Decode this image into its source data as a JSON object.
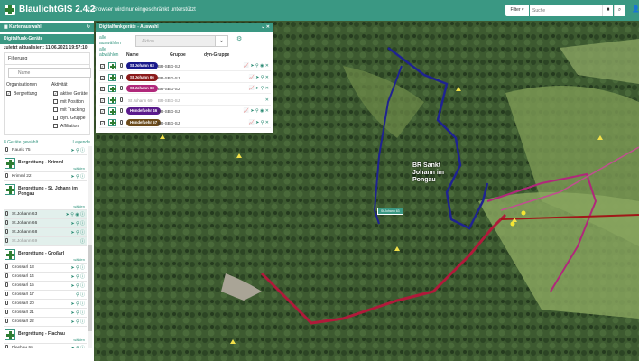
{
  "header": {
    "title": "BlaulichtGIS 2.4.2",
    "warning": "Browser wird nur eingeschränkt unterstützt",
    "filter_label": "Filter ▾",
    "search_placeholder": "Suche",
    "clear_icon": "■",
    "search_icon": "⌕",
    "user_icon": "👤"
  },
  "sidebar": {
    "map_select": "Kartenauswahl",
    "refresh_icon": "↻",
    "devices_title": "Digitalfunk-Geräte",
    "last_update": "zuletzt aktualisiert: 11.06.2021 19:57:10",
    "filter_title": "Filterung",
    "name_placeholder": "Name",
    "org_title": "Organisationen",
    "orgs": [
      {
        "label": "Bergrettung",
        "checked": true
      }
    ],
    "activity_title": "Aktivität",
    "activities": [
      {
        "label": "aktive Geräte",
        "checked": true
      },
      {
        "label": "mit Position",
        "checked": false
      },
      {
        "label": "mit Tracking",
        "checked": false
      },
      {
        "label": "dyn. Gruppe",
        "checked": false
      },
      {
        "label": "Affiliation",
        "checked": false
      }
    ],
    "selected_count": "8 Geräte gewählt",
    "legend": "Legende",
    "select_label": "wählen",
    "top_item": {
      "name": "Rauris 75",
      "icons": "➤ ⚲ ⓘ"
    },
    "groups": [
      {
        "name": "Bergrettung - Krimml",
        "items": [
          {
            "name": "Krimml 22",
            "icons": "➤ ⚲ ⓘ",
            "state": ""
          }
        ]
      },
      {
        "name": "Bergrettung - St. Johann im Pongau",
        "items": [
          {
            "name": "St.Johann 63",
            "icons": "➤ ⚲ ◉ ⓘ",
            "state": "sel"
          },
          {
            "name": "St.Johann 66",
            "icons": "➤ ⚲ ⓘ",
            "state": "sel"
          },
          {
            "name": "St.Johann 68",
            "icons": "➤ ⚲ ⓘ",
            "state": "sel"
          },
          {
            "name": "St.Johann 69",
            "icons": "ⓘ",
            "state": "dim"
          }
        ]
      },
      {
        "name": "Bergrettung - Großarl",
        "items": [
          {
            "name": "Grossarl 13",
            "icons": "➤ ⚲ ⓘ",
            "state": ""
          },
          {
            "name": "Grossarl 14",
            "icons": "➤ ⚲ ⓘ",
            "state": ""
          },
          {
            "name": "Grossarl 15",
            "icons": "➤ ⚲ ⓘ",
            "state": ""
          },
          {
            "name": "Grossarl 17",
            "icons": "⚲ ⓘ",
            "state": ""
          },
          {
            "name": "Grossarl 20",
            "icons": "➤ ⚲ ⓘ",
            "state": ""
          },
          {
            "name": "Grossarl 21",
            "icons": "➤ ⚲ ⓘ",
            "state": ""
          },
          {
            "name": "Grossarl 22",
            "icons": "➤ ⚲ ⓘ",
            "state": ""
          }
        ]
      },
      {
        "name": "Bergrettung - Flachau",
        "items": [
          {
            "name": "Flachau 66",
            "icons": "➤ ⚲ ⓘ",
            "state": ""
          }
        ]
      }
    ]
  },
  "popup": {
    "title": "Digitalfunkgeräte - Auswahl",
    "controls": "⌄ ✕",
    "select_all": "alle auswählen",
    "deselect_all": "alle abwählen",
    "action_placeholder": "Aktion",
    "dropdown_icon": "⌄",
    "gear_icon": "⚙",
    "columns": [
      "Name",
      "Gruppe",
      "dyn-Gruppe"
    ],
    "rows": [
      {
        "name": "St Johann 63",
        "group": "BR-SBG-SJ",
        "color": "#1a1a8c",
        "icons": "📈 ➤ ⚲ ◉ ✕",
        "active": true
      },
      {
        "name": "St Johann 66",
        "group": "BR-SBG-SJ",
        "color": "#8b1a1a",
        "icons": "📈 ➤ ⚲ ✕",
        "active": true
      },
      {
        "name": "St Johann 68",
        "group": "BR-SBG-SJ",
        "color": "#b0287a",
        "icons": "📈 ➤ ⚲ ✕",
        "active": true
      },
      {
        "name": "St Johann 69",
        "group": "BR-SBG-SJ",
        "color": "",
        "icons": "✕",
        "active": false
      },
      {
        "name": "Hundefuehr 46",
        "group": "BR-SBG-SJ",
        "color": "#5a1a8c",
        "icons": "📈 ➤ ⚲ ◉ ✕",
        "active": true
      },
      {
        "name": "Hundefuehr 57",
        "group": "BR-SBG-SJ",
        "color": "#6b4a1a",
        "icons": "📈 ➤ ⚲ ✕",
        "active": true
      }
    ]
  },
  "map": {
    "label": "BR Sankt Johann im Pongau",
    "pin_label": "St.Johann 63"
  }
}
